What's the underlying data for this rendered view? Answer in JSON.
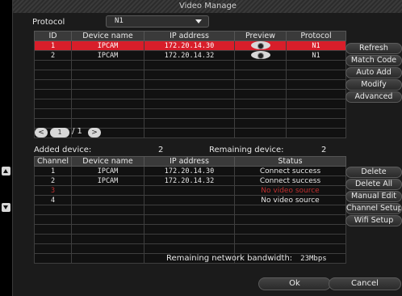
{
  "window": {
    "title": "Video Manage"
  },
  "protocol": {
    "label": "Protocol",
    "selected": "N1"
  },
  "device_table": {
    "headers": [
      "ID",
      "Device name",
      "IP address",
      "Preview",
      "Protocol"
    ],
    "rows": [
      {
        "id": "1",
        "name": "IPCAM",
        "ip": "172.20.14.30",
        "protocol": "N1",
        "selected": true
      },
      {
        "id": "2",
        "name": "IPCAM",
        "ip": "172.20.14.32",
        "protocol": "N1",
        "selected": false
      }
    ],
    "total_rows": 10
  },
  "side_buttons_top": [
    "Refresh",
    "Match Code",
    "Auto Add",
    "Modify",
    "Advanced"
  ],
  "pager": {
    "prev": "<",
    "page": "1",
    "total_text": "/ 1",
    "next": ">"
  },
  "added": {
    "label": "Added device:",
    "value": "2"
  },
  "remaining": {
    "label": "Remaining device:",
    "value": "2"
  },
  "channel_table": {
    "headers": [
      "Channel",
      "Device name",
      "IP address",
      "Status"
    ],
    "rows": [
      {
        "channel": "1",
        "name": "IPCAM",
        "ip": "172.20.14.30",
        "status": "Connect success",
        "red": false
      },
      {
        "channel": "2",
        "name": "IPCAM",
        "ip": "172.20.14.32",
        "status": "Connect success",
        "red": false
      },
      {
        "channel": "3",
        "name": "",
        "ip": "",
        "status": "No video source",
        "red": true
      },
      {
        "channel": "4",
        "name": "",
        "ip": "",
        "status": "No video source",
        "red": false
      }
    ],
    "total_rows": 10
  },
  "side_buttons_bottom": [
    "Delete",
    "Delete All",
    "Manual Edit",
    "Channel Setup",
    "Wifi Setup"
  ],
  "bandwidth": {
    "label": "Remaining network bandwidth:",
    "value": "23Mbps"
  },
  "buttons": {
    "ok": "Ok",
    "cancel": "Cancel"
  },
  "colors": {
    "selected_row": "#d81e2a",
    "error_text": "#c23030",
    "background": "#1b1b1b"
  }
}
